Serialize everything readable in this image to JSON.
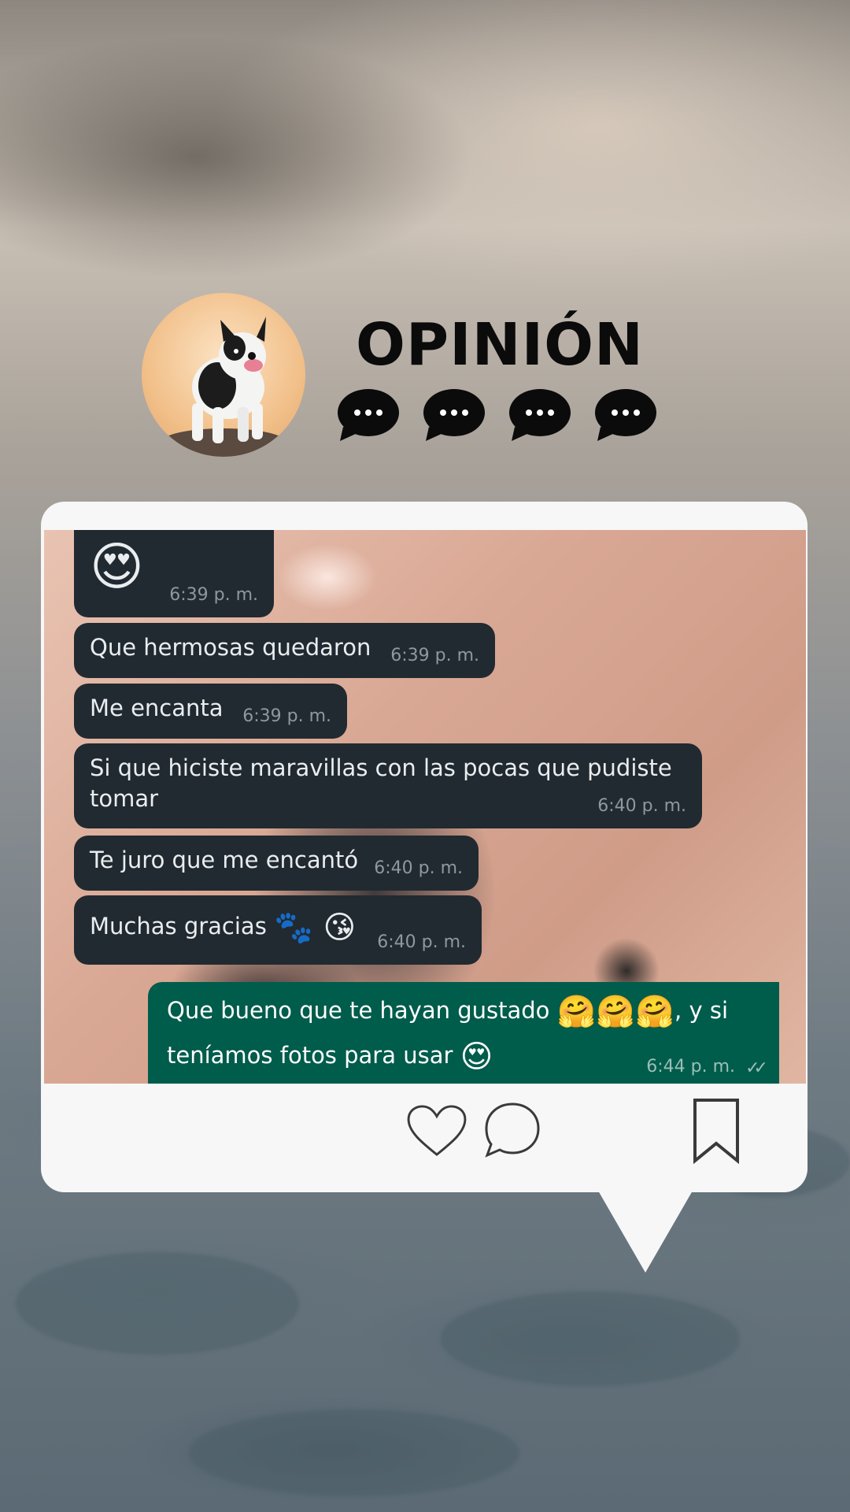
{
  "header": {
    "title": "OPINIÓN",
    "avatar_icon": "dog-avatar-icon",
    "typing_icons": [
      "typing-bubble-icon",
      "typing-bubble-icon",
      "typing-bubble-icon",
      "typing-bubble-icon"
    ]
  },
  "messages": [
    {
      "text": "",
      "emoji": "😍",
      "time": "6:39 p. m.",
      "direction": "in"
    },
    {
      "text": "Que hermosas quedaron",
      "time": "6:39 p. m.",
      "direction": "in"
    },
    {
      "text": "Me encanta",
      "time": "6:39 p. m.",
      "direction": "in"
    },
    {
      "text": "Si que hiciste maravillas con las pocas que pudiste tomar",
      "time": "6:40 p. m.",
      "direction": "in"
    },
    {
      "text": "Te juro que me encantó",
      "time": "6:40 p. m.",
      "direction": "in"
    },
    {
      "text": "Muchas gracias",
      "emoji": "🐾 😘",
      "time": "6:40 p. m.",
      "direction": "in"
    },
    {
      "text": "Que bueno que te hayan gustado",
      "emoji": "🤗🤗🤗",
      "text_after": ", y si",
      "text_line2": "teníamos fotos para usar",
      "emoji2": "😍",
      "time": "6:44 p. m.",
      "direction": "out"
    }
  ],
  "actions": {
    "like_icon": "heart-icon",
    "comment_icon": "comment-icon",
    "save_icon": "bookmark-icon"
  },
  "colors": {
    "card": "#f7f7f7",
    "incoming_bubble": "#212a31",
    "outgoing_bubble": "#005c4b",
    "title": "#0b0b0b"
  }
}
